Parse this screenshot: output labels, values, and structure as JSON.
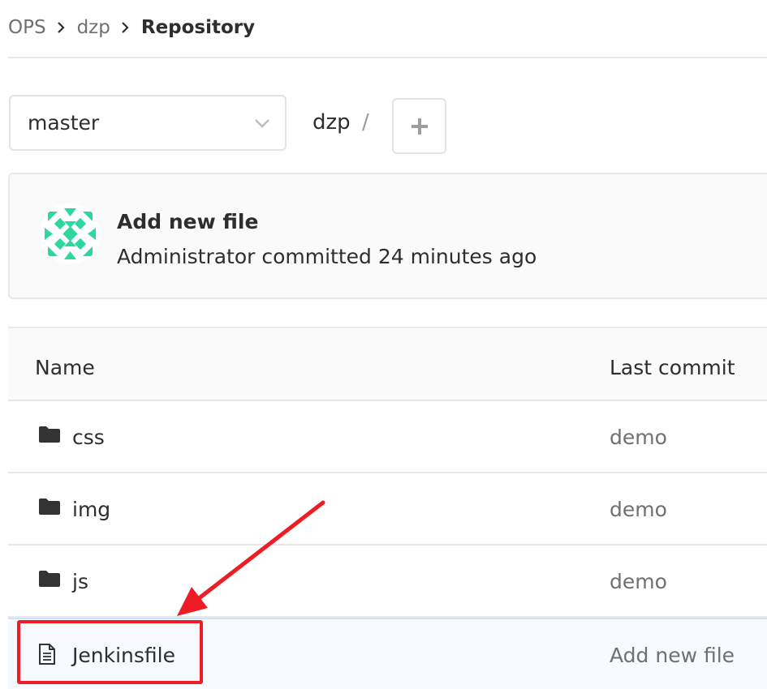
{
  "breadcrumb": {
    "items": [
      "OPS",
      "dzp",
      "Repository"
    ]
  },
  "branch": {
    "selected": "master"
  },
  "path": {
    "segment": "dzp",
    "separator": "/"
  },
  "commit": {
    "title": "Add new file",
    "meta": "Administrator committed 24 minutes ago"
  },
  "table": {
    "headers": {
      "name": "Name",
      "last_commit": "Last commit"
    },
    "rows": [
      {
        "name": "css",
        "commit": "demo",
        "type": "folder-icon"
      },
      {
        "name": "img",
        "commit": "demo",
        "type": "folder-icon"
      },
      {
        "name": "js",
        "commit": "demo",
        "type": "folder-icon"
      },
      {
        "name": "Jenkinsfile",
        "commit": "Add new file",
        "type": "file-icon"
      }
    ]
  },
  "colors": {
    "annotation": "#ee1c25",
    "avatar_accent": "#2ed6a0",
    "highlight_row": "#f6fafe"
  }
}
